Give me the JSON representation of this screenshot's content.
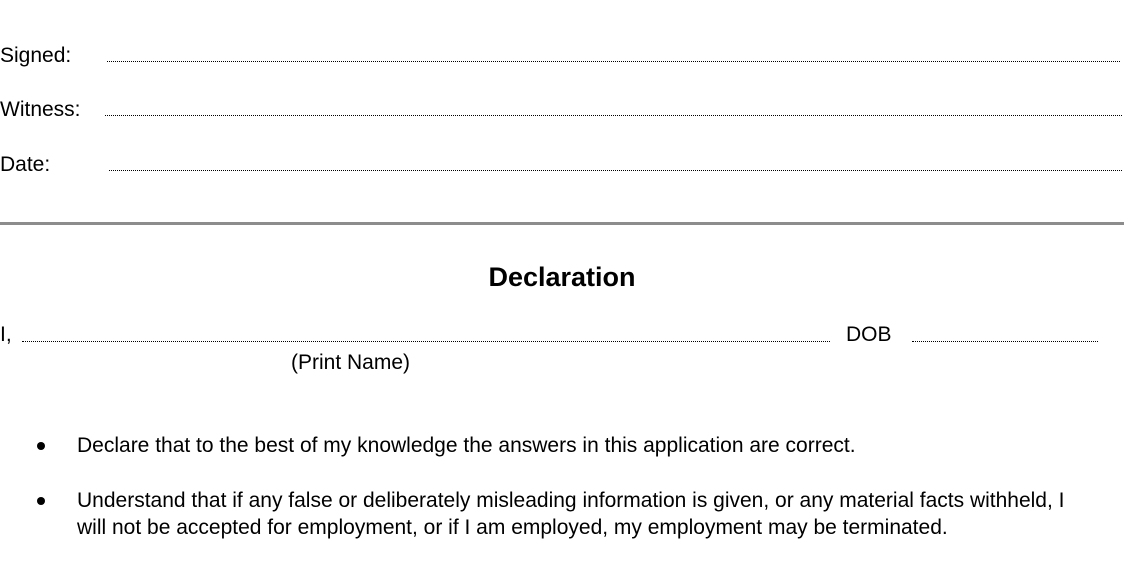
{
  "signoff": {
    "signed_label": "Signed:",
    "witness_label": "Witness:",
    "date_label": "Date:"
  },
  "declaration": {
    "heading": "Declaration",
    "i_prefix": "I,",
    "dob_label": "DOB",
    "print_name_caption": "(Print Name)",
    "bullets": [
      "Declare that to the best of my knowledge the answers in this application are correct.",
      "Understand that if any false or deliberately misleading information is given, or any material facts withheld, I will not be accepted for employment, or if I am employed, my employment may be terminated."
    ]
  }
}
